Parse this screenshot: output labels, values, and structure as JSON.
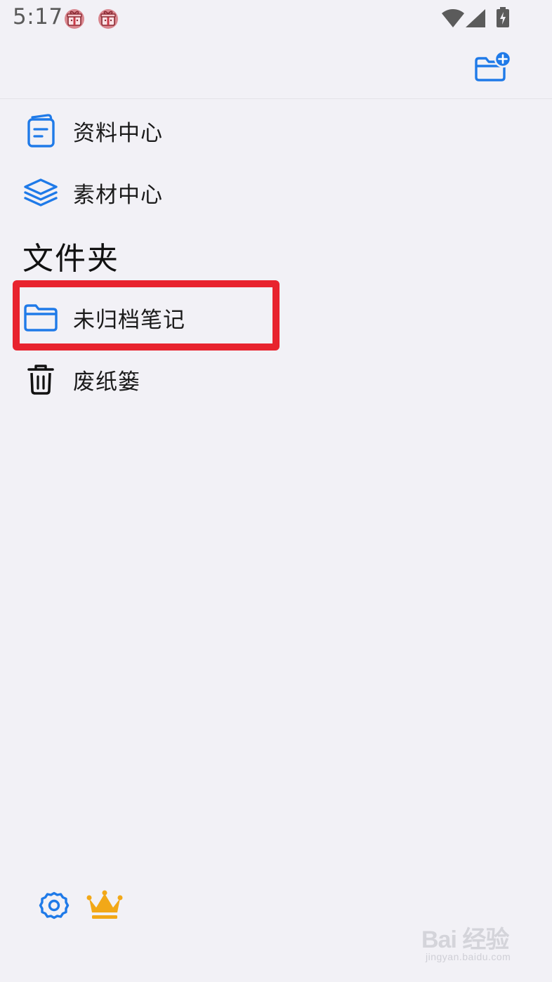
{
  "status_bar": {
    "time": "5:17",
    "notification_icons": [
      "gift-icon",
      "gift-icon"
    ],
    "system_icons": [
      "wifi-icon",
      "signal-icon",
      "battery-charging-icon"
    ]
  },
  "header": {
    "new_folder_icon": "folder-plus-icon"
  },
  "nav": {
    "items": [
      {
        "label": "资料中心",
        "icon": "document-icon"
      },
      {
        "label": "素材中心",
        "icon": "layers-icon"
      }
    ]
  },
  "folders": {
    "title": "文件夹",
    "items": [
      {
        "label": "未归档笔记",
        "icon": "folder-icon",
        "highlighted": true
      },
      {
        "label": "废纸篓",
        "icon": "trash-icon"
      }
    ]
  },
  "footer": {
    "icons": [
      "settings-icon",
      "crown-icon"
    ]
  },
  "watermark": {
    "brand": "Bai 经验",
    "url": "jingyan.baidu.com"
  },
  "colors": {
    "accent": "#1f7ae8",
    "background": "#f2f1f6",
    "highlight": "#e8232e",
    "crown": "#f2a818"
  }
}
